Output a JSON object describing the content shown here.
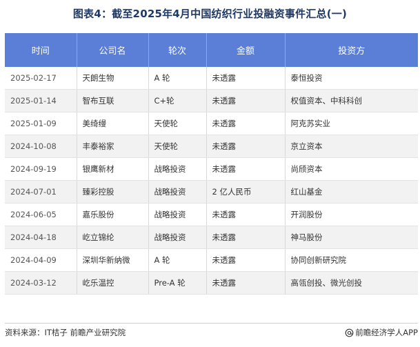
{
  "title": "图表4：截至2025年4月中国纺织行业投融资事件汇总(一)",
  "table": {
    "headers": [
      "时间",
      "公司名",
      "轮次",
      "金额",
      "投资方"
    ],
    "rows": [
      [
        "2025-02-17",
        "天朗生物",
        "A 轮",
        "未透露",
        "泰恒投资"
      ],
      [
        "2025-01-14",
        "智布互联",
        "C+轮",
        "未透露",
        "权值资本、中科科创"
      ],
      [
        "2025-01-09",
        "美绮缦",
        "天使轮",
        "未透露",
        "阿克苏实业"
      ],
      [
        "2024-10-08",
        "丰泰裕家",
        "天使轮",
        "未透露",
        "京立资本"
      ],
      [
        "2024-09-19",
        "银鹰新材",
        "战略投资",
        "未透露",
        "尚颀资本"
      ],
      [
        "2024-07-01",
        "臻彩控股",
        "战略投资",
        "2 亿人民币",
        "红山基金"
      ],
      [
        "2024-06-05",
        "嘉乐股份",
        "战略投资",
        "未透露",
        "开润股份"
      ],
      [
        "2024-04-18",
        "屹立锦纶",
        "战略投资",
        "未透露",
        "神马股份"
      ],
      [
        "2024-04-09",
        "深圳华新纳微",
        "A 轮",
        "未透露",
        "协同创新研究院"
      ],
      [
        "2024-03-12",
        "屹乐温控",
        "Pre-A 轮",
        "未透露",
        "高瓴创投、微光创投"
      ]
    ]
  },
  "footer": {
    "source": "资料来源：IT桔子 前瞻产业研究院",
    "brand": "前瞻经济学人APP",
    "brand_icon": "at-sign-icon"
  },
  "colors": {
    "header_bg": "#5b7fd6",
    "title": "#1f3864",
    "stripe": "#f2f2f2"
  }
}
